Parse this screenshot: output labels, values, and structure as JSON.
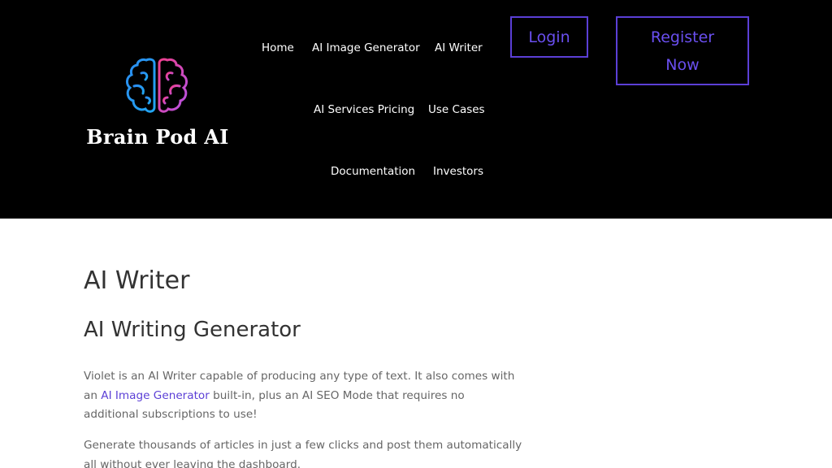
{
  "brand": {
    "name": "Brain Pod AI",
    "logo_icon": "brain-icon",
    "colors": {
      "left_hemisphere": "#1e90ff",
      "right_hemisphere": "#e0479e",
      "accent": "#5b3fd6"
    }
  },
  "nav": {
    "items": [
      {
        "label": "Home"
      },
      {
        "label": "AI Image Generator"
      },
      {
        "label": "AI Writer"
      },
      {
        "label": "AI Services Pricing"
      },
      {
        "label": "Use Cases"
      },
      {
        "label": "Documentation"
      },
      {
        "label": "Investors"
      }
    ]
  },
  "auth": {
    "login_label": "Login",
    "register_line1": "Register",
    "register_line2": "Now"
  },
  "main": {
    "title": "AI Writer",
    "subtitle": "AI Writing Generator",
    "p1_before": "Violet is an AI Writer capable of producing any type of text.  It also comes with an ",
    "p1_link": "AI Image Generator",
    "p1_after": " built-in, plus an AI SEO Mode that requires no additional subscriptions to use!",
    "p2": "Generate thousands of articles in just a few clicks and post them automatically all without ever leaving the dashboard."
  }
}
